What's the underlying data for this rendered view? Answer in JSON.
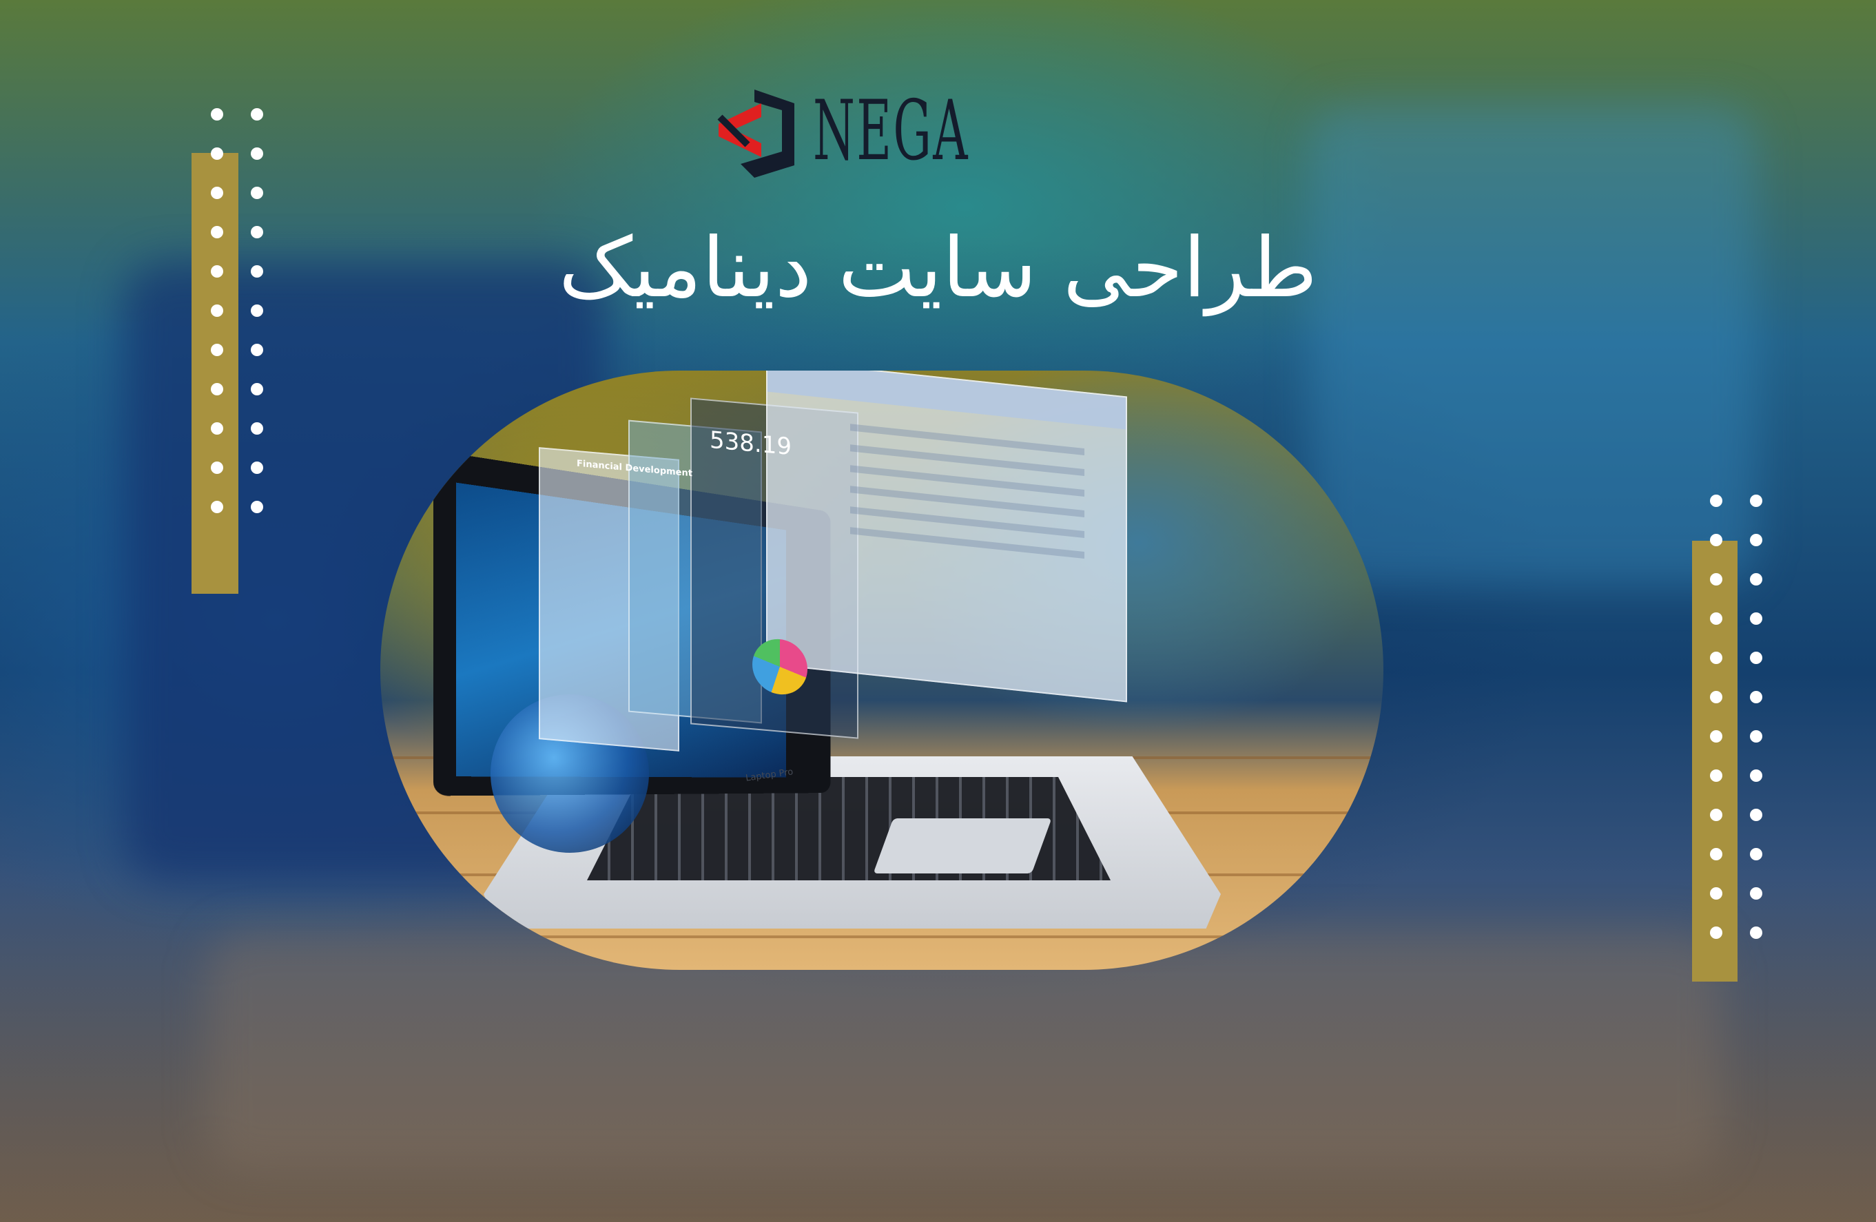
{
  "brand": {
    "logo_text": "NEGA",
    "logo_name": "nega-logo-icon"
  },
  "title": "طراحی سایت دینامیک",
  "hero": {
    "image_subject": "laptop-with-floating-app-windows",
    "screen_number": "538.19",
    "screen_heading": "Financial Development",
    "laptop_brand": "Laptop Pro"
  },
  "colors": {
    "accent_gold": "#a8923f",
    "logo_red": "#e02020",
    "logo_dark": "#141c2c",
    "title_text": "#ffffff"
  }
}
